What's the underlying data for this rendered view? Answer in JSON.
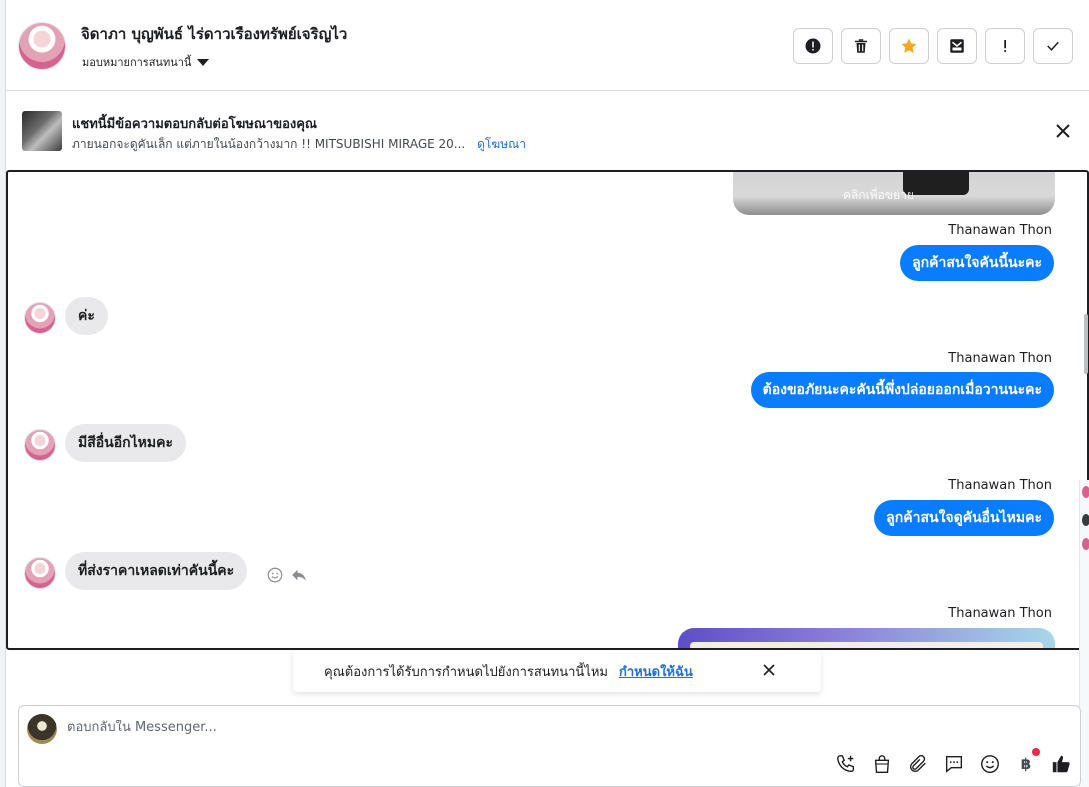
{
  "header": {
    "contact_name": "จิดาภา บุญพันธ์ ไร่ดาวเรืองทรัพย์เจริญไว",
    "assign_label": "มอบหมายการสนทนานี้",
    "actions": [
      {
        "name": "report-spam",
        "icon": "alert-circle-icon"
      },
      {
        "name": "delete",
        "icon": "trash-icon"
      },
      {
        "name": "star",
        "icon": "star-icon",
        "color": "#f5a623"
      },
      {
        "name": "move-to-inbox",
        "icon": "archive-icon"
      },
      {
        "name": "mark-follow-up",
        "icon": "exclamation-icon"
      },
      {
        "name": "mark-done",
        "icon": "check-icon"
      }
    ]
  },
  "ad_banner": {
    "title": "แชทนี้มีข้อความตอบกลับต่อโฆษณาของคุณ",
    "description": "ภายนอกจะดูคันเล็ก แต่ภายในน้องกว้างมาก !! MITSUBISHI MIRAGE 20...",
    "link": "ดูโฆษณา"
  },
  "conversation": {
    "image_caption": "คลิกเพื่อขยาย",
    "messages": [
      {
        "direction": "out",
        "sender": "Thanawan Thon",
        "text": "ลูกค้าสนใจคันนี้นะคะ"
      },
      {
        "direction": "in",
        "text": "ค่ะ"
      },
      {
        "direction": "out",
        "sender": "Thanawan Thon",
        "text": "ต้องขอภัยนะคะคันนี้พึ่งปล่อยออกเมื่อวานนะคะ"
      },
      {
        "direction": "in",
        "text": "มีสีอื่นอีกไหมคะ"
      },
      {
        "direction": "out",
        "sender": "Thanawan Thon",
        "text": "ลูกค้าสนใจดูคันอื่นไหมคะ"
      },
      {
        "direction": "in",
        "text": "ที่ส่งราคาเหลดเท่าคันนี้คะ"
      },
      {
        "direction": "out",
        "sender": "Thanawan Thon",
        "text": ""
      }
    ]
  },
  "reminder": {
    "text": "คุณต้องการได้รับการกำหนดไปยังการสนทนานี้ไหม",
    "link": "กำหนดให้ฉัน"
  },
  "composer": {
    "placeholder": "ตอบกลับใน Messenger...",
    "tools": [
      "call-add-icon",
      "shopping-bag-icon",
      "paperclip-icon",
      "chat-bubble-icon",
      "emoji-icon",
      "baht-icon",
      "thumbs-up-icon"
    ],
    "baht_symbol": "฿"
  },
  "colors": {
    "accent": "#0a7cff",
    "link": "#216fdb",
    "star": "#f5a623",
    "incoming_bubble": "#e9e9eb",
    "notification": "#f02849"
  }
}
